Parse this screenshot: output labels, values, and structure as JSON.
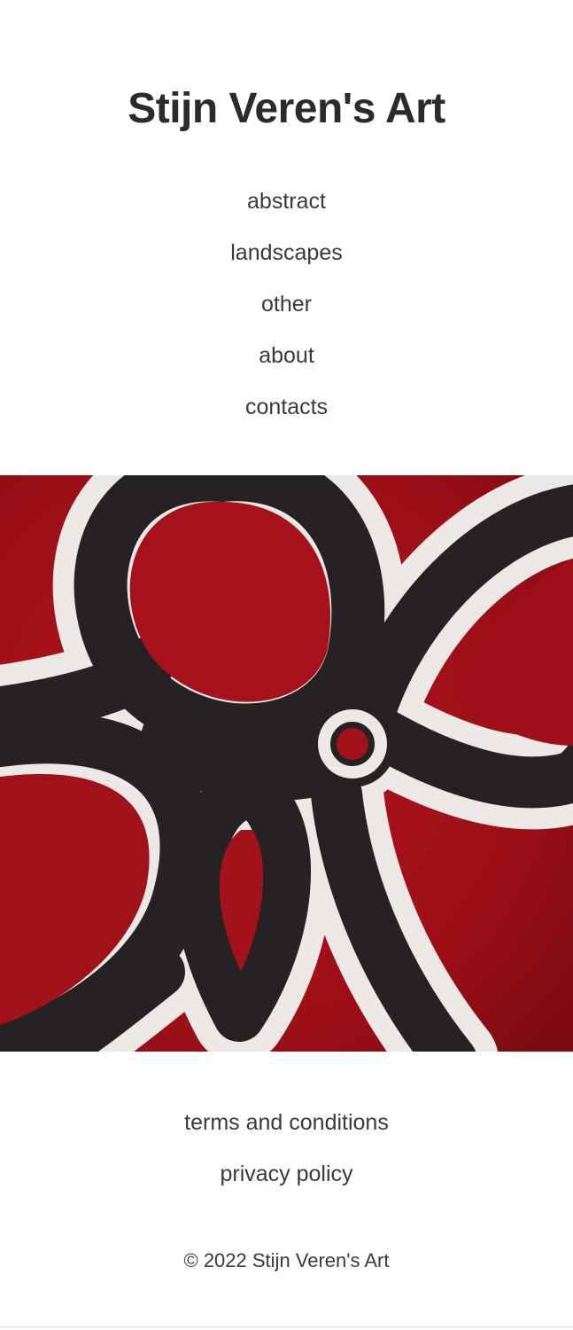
{
  "site": {
    "title": "Stijn Veren's Art"
  },
  "nav": {
    "items": [
      {
        "label": "abstract"
      },
      {
        "label": "landscapes"
      },
      {
        "label": "other"
      },
      {
        "label": "about"
      },
      {
        "label": "contacts"
      }
    ]
  },
  "hero": {
    "colors": {
      "background": "#a3111a",
      "band": "#262123",
      "outline": "#ece8e6"
    }
  },
  "footer": {
    "links": [
      {
        "label": "terms and conditions"
      },
      {
        "label": "privacy policy"
      }
    ],
    "copyright": "© 2022 Stijn Veren's Art"
  }
}
